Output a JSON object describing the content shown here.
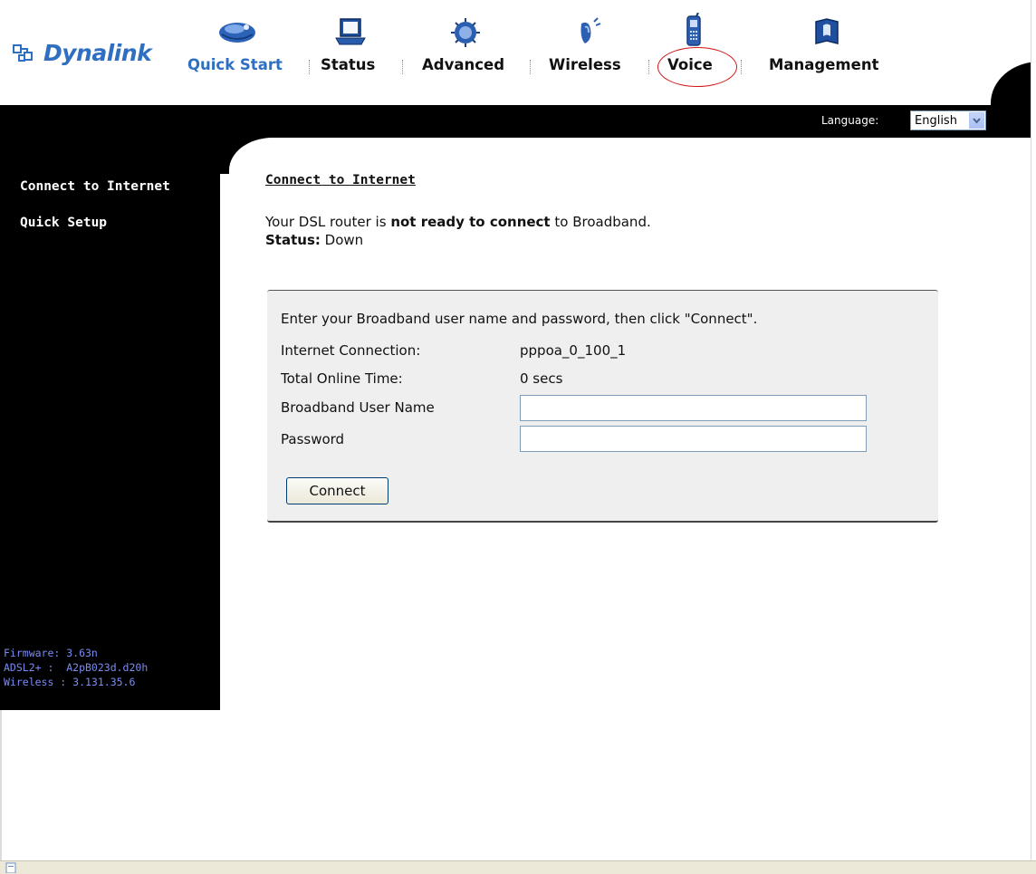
{
  "brand": {
    "name": "Dynalink",
    "color": "#2f6fc1"
  },
  "nav": {
    "items": [
      {
        "label": "Quick Start",
        "icon": "mouse-icon",
        "active": true
      },
      {
        "label": "Status",
        "icon": "laptop-icon",
        "active": false
      },
      {
        "label": "Advanced",
        "icon": "chip-icon",
        "active": false
      },
      {
        "label": "Wireless",
        "icon": "wireless-antenna-icon",
        "active": false
      },
      {
        "label": "Voice",
        "icon": "phone-icon",
        "active": false,
        "highlighted": true
      },
      {
        "label": "Management",
        "icon": "book-icon",
        "active": false
      }
    ],
    "highlight_color": "#d21414"
  },
  "language": {
    "label": "Language:",
    "selected": "English"
  },
  "sidebar": {
    "links": [
      "Connect to Internet",
      "Quick Setup"
    ],
    "firmware": {
      "line1": "Firmware: 3.63n",
      "line2": "ADSL2+ :  A2pB023d.d20h",
      "line3": "Wireless : 3.131.35.6"
    }
  },
  "main": {
    "title": "Connect to Internet",
    "status_prefix": "Your DSL router is ",
    "status_bold": "not ready to connect",
    "status_suffix": " to Broadband.",
    "status_label": "Status:",
    "status_value": " Down",
    "panel": {
      "instruction": "Enter your Broadband user name and password, then click \"Connect\".",
      "connection_label": "Internet Connection:",
      "connection_value": "pppoa_0_100_1",
      "online_label": "Total Online Time:",
      "online_value": "0 secs",
      "username_label": "Broadband User Name",
      "username_value": "",
      "password_label": "Password",
      "password_value": "",
      "connect_button": "Connect"
    }
  }
}
